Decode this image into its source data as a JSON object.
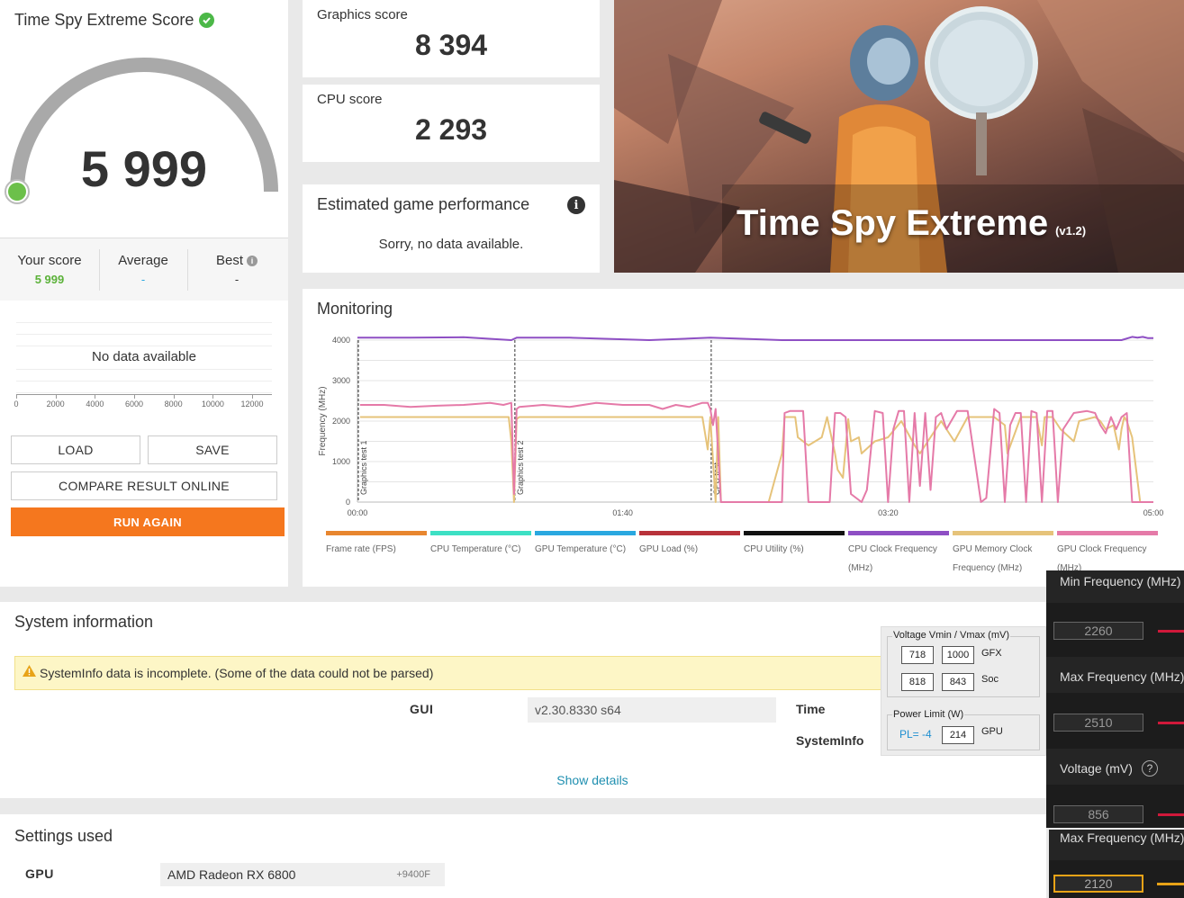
{
  "score_card": {
    "title": "Time Spy Extreme Score",
    "score": "5 999",
    "your_score_label": "Your score",
    "your_score_value": "5 999",
    "average_label": "Average",
    "average_value": "-",
    "best_label": "Best",
    "best_value": "-",
    "no_data": "No data available",
    "axis_ticks": [
      "0",
      "2000",
      "4000",
      "6000",
      "8000",
      "10000",
      "12000"
    ],
    "load_label": "LOAD",
    "save_label": "SAVE",
    "compare_label": "COMPARE RESULT ONLINE",
    "run_again_label": "RUN AGAIN"
  },
  "graphics_score": {
    "label": "Graphics score",
    "value": "8 394"
  },
  "cpu_score": {
    "label": "CPU score",
    "value": "2 293"
  },
  "game_perf": {
    "title": "Estimated game performance",
    "message": "Sorry, no data available."
  },
  "banner": {
    "title": "Time Spy Extreme",
    "version": "(v1.2)"
  },
  "monitoring": {
    "title": "Monitoring",
    "legend": [
      {
        "label": "Frame rate (FPS)",
        "color": "#e8862f"
      },
      {
        "label": "CPU Temperature (°C)",
        "color": "#3de0c4"
      },
      {
        "label": "GPU Temperature (°C)",
        "color": "#2aa8e0"
      },
      {
        "label": "GPU Load (%)",
        "color": "#b8323a"
      },
      {
        "label": "CPU Utility (%)",
        "color": "#111111"
      },
      {
        "label": "CPU Clock Frequency (MHz)",
        "color": "#8e4fc4"
      },
      {
        "label": "GPU Memory Clock Frequency (MHz)",
        "color": "#e6c37a"
      },
      {
        "label": "GPU Clock Frequency (MHz)",
        "color": "#e57aa8"
      }
    ]
  },
  "chart_data": {
    "type": "line",
    "ylabel": "Frequency (MHz)",
    "ylim": [
      0,
      4000
    ],
    "y_ticks": [
      "0",
      "1000",
      "2000",
      "3000",
      "4000"
    ],
    "x_ticks": [
      "00:00",
      "01:40",
      "03:20",
      "05:00"
    ],
    "xlim_seconds": [
      0,
      300
    ],
    "markers": [
      {
        "label": "Graphics test 1",
        "x": 0
      },
      {
        "label": "Graphics test 2",
        "x": 59
      },
      {
        "label": "CPU test",
        "x": 133
      }
    ],
    "grid": true,
    "series": [
      {
        "name": "CPU Clock Frequency (MHz)",
        "color": "#8e4fc4",
        "x": [
          0,
          20,
          40,
          58,
          60,
          80,
          110,
          133,
          160,
          200,
          240,
          280,
          288,
          292,
          294,
          296,
          298,
          300
        ],
        "y": [
          4060,
          4060,
          4070,
          4000,
          4060,
          4060,
          4000,
          4060,
          4000,
          4000,
          4000,
          4000,
          4000,
          4080,
          4060,
          4080,
          4050,
          4050
        ]
      },
      {
        "name": "GPU Memory Clock Frequency (MHz)",
        "color": "#e6c37a",
        "x": [
          1,
          55,
          57,
          58,
          59,
          60,
          61,
          130,
          132,
          133,
          135,
          136,
          137,
          150,
          155,
          160,
          161,
          163,
          165,
          166,
          170,
          175,
          177,
          180,
          181,
          183,
          185,
          186,
          189,
          190,
          195,
          200,
          205,
          210,
          212,
          215,
          220,
          225,
          230,
          240,
          244,
          245,
          250,
          252,
          256,
          258,
          259,
          262,
          265,
          270,
          272,
          278,
          280,
          282,
          285,
          287,
          288,
          289,
          290,
          292,
          295,
          300
        ],
        "y": [
          2100,
          2100,
          2100,
          1500,
          0,
          2050,
          2100,
          2100,
          1300,
          2100,
          0,
          2100,
          0,
          0,
          0,
          1200,
          2100,
          2100,
          2100,
          1600,
          1400,
          1600,
          2100,
          1200,
          800,
          600,
          2050,
          1500,
          1600,
          1200,
          1500,
          1600,
          2000,
          1400,
          1200,
          1500,
          2000,
          1500,
          2100,
          2100,
          1900,
          1200,
          2100,
          2100,
          2100,
          1400,
          2100,
          2100,
          1800,
          1500,
          2000,
          2100,
          2000,
          1800,
          1900,
          1300,
          1800,
          2100,
          2000,
          1600,
          0,
          0
        ]
      },
      {
        "name": "GPU Clock Frequency (MHz)",
        "color": "#e57aa8",
        "x": [
          1,
          10,
          20,
          30,
          40,
          50,
          55,
          58,
          59,
          60,
          61,
          70,
          80,
          90,
          100,
          110,
          115,
          120,
          125,
          130,
          132,
          133,
          134,
          135,
          137,
          138,
          140,
          145,
          150,
          155,
          160,
          161,
          163,
          165,
          168,
          170,
          172,
          175,
          178,
          180,
          182,
          184,
          186,
          188,
          190,
          192,
          195,
          198,
          200,
          202,
          204,
          206,
          208,
          210,
          212,
          214,
          216,
          218,
          220,
          222,
          226,
          228,
          230,
          235,
          237,
          240,
          242,
          244,
          246,
          248,
          250,
          252,
          254,
          256,
          258,
          260,
          262,
          264,
          266,
          270,
          275,
          278,
          280,
          282,
          284,
          286,
          288,
          290,
          292,
          295,
          300
        ],
        "y": [
          2400,
          2400,
          2350,
          2380,
          2400,
          2450,
          2400,
          2450,
          200,
          2300,
          2350,
          2400,
          2350,
          2450,
          2400,
          2400,
          2300,
          2400,
          2350,
          2450,
          2450,
          2300,
          1900,
          2300,
          0,
          0,
          0,
          0,
          0,
          0,
          0,
          2200,
          2250,
          2250,
          2250,
          0,
          0,
          0,
          0,
          2200,
          2200,
          2100,
          200,
          100,
          0,
          300,
          2250,
          2200,
          0,
          1800,
          2250,
          2250,
          0,
          2200,
          400,
          2200,
          300,
          2100,
          2200,
          1800,
          2250,
          2250,
          2250,
          0,
          100,
          2300,
          2200,
          0,
          1900,
          2200,
          2200,
          0,
          2250,
          2200,
          0,
          2250,
          2250,
          0,
          1800,
          2200,
          2250,
          2200,
          1900,
          1700,
          2100,
          1800,
          2100,
          2200,
          0,
          0,
          0
        ]
      }
    ]
  },
  "system_info": {
    "title": "System information",
    "warning": "SystemInfo data is incomplete. (Some of the data could not be parsed)",
    "gui_label": "GUI",
    "gui_value": "v2.30.8330 s64",
    "time_label": "Time",
    "sysinfo_label": "SystemInfo",
    "show_details": "Show details"
  },
  "settings": {
    "title": "Settings used",
    "gpu_label": "GPU",
    "gpu_value": "AMD Radeon RX 6800",
    "gpu_suffix": "+9400F"
  },
  "voltage_panel": {
    "title": "Voltage Vmin / Vmax (mV)",
    "gfx_min": "718",
    "gfx_max": "1000",
    "gfx_label": "GFX",
    "soc_min": "818",
    "soc_max": "843",
    "soc_label": "Soc",
    "power_title": "Power Limit (W)",
    "pl_value": "PL= -4",
    "power_value": "214",
    "power_label": "GPU"
  },
  "tuning_panel": {
    "min_freq_label": "Min Frequency (MHz)",
    "min_freq_value": "2260",
    "max_freq_label": "Max Frequency (MHz)",
    "max_freq_value": "2510",
    "voltage_label": "Voltage (mV)",
    "voltage_value": "856",
    "mem_max_freq_label": "Max Frequency (MHz)",
    "mem_max_freq_value": "2120"
  }
}
